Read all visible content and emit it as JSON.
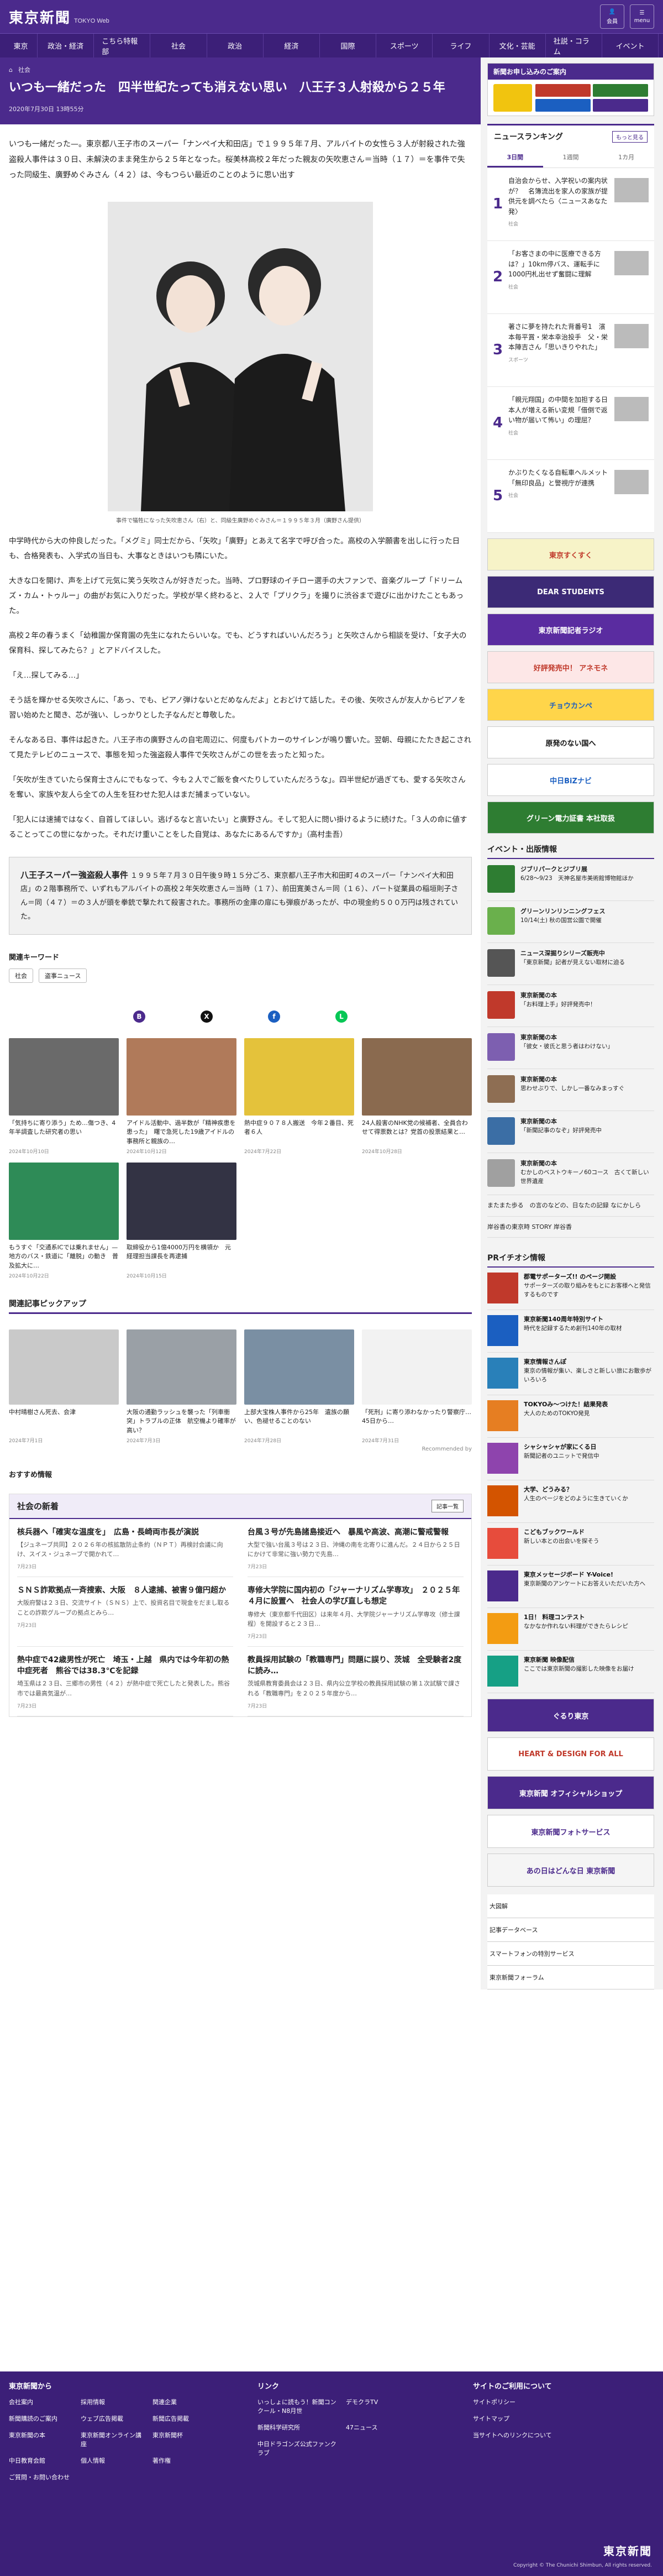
{
  "header": {
    "logo": "東京新聞",
    "logo_sub": "TOKYO Web",
    "btn_member": "会員",
    "btn_menu": "menu"
  },
  "nav": [
    "東京",
    "政治・経済",
    "こちら特報部",
    "社会",
    "政治",
    "経済",
    "国際",
    "スポーツ",
    "ライフ",
    "文化・芸能",
    "社説・コラム",
    "イベント"
  ],
  "article": {
    "breadcrumb_home": "⌂",
    "breadcrumb": "社会",
    "title": "いつも一緒だった　四半世紀たっても消えない思い　八王子３人射殺から２５年",
    "date": "2020年7月30日 13時55分",
    "lead": "いつも一緒だった—。東京都八王子市のスーパー「ナンペイ大和田店」で１９９５年７月、アルバイトの女性ら３人が射殺された強盗殺人事件は３０日、未解決のまま発生から２５年となった。桜美林高校２年だった親友の矢吹恵さん＝当時（１７）＝を事件で失った同級生、廣野めぐみさん（４２）は、今もつらい最近のことのように思い出す",
    "photo_caption": "事件で犠牲になった矢吹恵さん（右）と、同級生廣野めぐみさん＝１９９５年３月（廣野さん提供）",
    "paras": [
      "中学時代から大の仲良しだった。「メグミ」同士だから、「矢吹」「廣野」とあえて名字で呼び合った。高校の入学願書を出しに行った日も、合格発表も、入学式の当日も、大事なときはいつも隣にいた。",
      "大きな口を開け、声を上げて元気に笑う矢吹さんが好きだった。当時、プロ野球のイチロー選手の大ファンで、音楽グループ「ドリームズ・カム・トゥルー」の曲がお気に入りだった。学校が早く終わると、２人で「プリクラ」を撮りに渋谷まで遊びに出かけたこともあった。",
      "高校２年の春うまく「幼稚園か保育園の先生になれたらいいな。でも、どうすればいいんだろう」と矢吹さんから相談を受け、「女子大の保育科、探してみたら？」とアドバイスした。",
      "「え…探してみる…」",
      "そう話を輝かせる矢吹さんに、「あっ、でも、ピアノ弾けないとだめなんだよ」とおどけて話した。その後、矢吹さんが友人からピアノを習い始めたと聞き、芯が強い、しっかりとした子なんだと尊敬した。",
      "そんなある日、事件は起きた。八王子市の廣野さんの自宅周辺に、何度もパトカーのサイレンが鳴り響いた。翌朝、母親にたたき起こされて見たテレビのニュースで、事態を知った強盗殺人事件で矢吹さんがこの世を去ったと知った。",
      "「矢吹が生きていたら保育士さんにでもなって、今も２人でご飯を食べたりしていたんだろうな」。四半世紀が過ぎても、愛する矢吹さんを奪い、家族や友人ら全ての人生を狂わせた犯人はまだ捕まっていない。",
      "「犯人には速捕ではなく、自首してほしい。逃げるなと言いたい」と廣野さん。そして犯人に問い掛けるように続けた。「３人の命に値することってこの世になかった。それだけ重いことをした自覚は、あなたにあるんですか」（高村圭吾）"
    ],
    "box_title": "八王子スーパー強盗殺人事件",
    "box_text": "１９９５年７月３０日午後９時１５分ごろ、東京都八王子市大和田町４のスーパー「ナンペイ大和田店」の２階事務所で、いずれもアルバイトの高校２年矢吹恵さん＝当時（１７）、前田寛美さん＝同（１６）、パート従業員の稲垣則子さん＝同（４７）＝の３人が頭を拳銃で撃たれて殺害された。事務所の金庫の扉にも弾痕があったが、中の現金約５００万円は残されていた。",
    "kw_title": "関連キーワード",
    "keywords": [
      "社会",
      "盗事ニュース"
    ]
  },
  "share": [
    {
      "c": "#4b2a8c",
      "t": "B"
    },
    {
      "c": "#111",
      "t": "X"
    },
    {
      "c": "#1b5fc1",
      "t": "f"
    },
    {
      "c": "#06c755",
      "t": "L"
    }
  ],
  "related": [
    {
      "t": "「気持ちに寄り添う」ため…傷つき、4年半調査した研究者の思い",
      "d": "2024年10月10日"
    },
    {
      "t": "アイドル活動中、過半数が「精神疾患を患った」　曙で急死した19歳アイドルの事務所と親族の…",
      "d": "2024年10月12日"
    },
    {
      "t": "熱中症９０７８人搬送　今年２番目、死者６人",
      "d": "2024年7月22日"
    },
    {
      "t": "24人殺害のNHK党の候補者、全員合わせて得票数とは？党首の投票結果と…",
      "d": "2024年10月28日"
    },
    {
      "t": "もうすぐ「交通系ICでは乗れません」—地方のバス・鉄道に「離脱」の動き　普及拡大に…",
      "d": "2024年10月22日"
    },
    {
      "t": "取締役から1億4000万円を横領か　元経理担当課長を再逮捕",
      "d": "2024年10月15日"
    }
  ],
  "pick_title": "関連記事ピックアップ",
  "picks": [
    {
      "t": "中村晴樹さん死去、会津",
      "d": "2024年7月1日"
    },
    {
      "t": "大阪の通勤ラッシュを襲った「列車衝突」トラブルの正体　航空機より確率が高い？",
      "d": "2024年7月3日"
    },
    {
      "t": "上部大宝株人事件から25年　遺族の願い、色褪せることのない",
      "d": "2024年7月28日"
    },
    {
      "t": "「死刑」に寄り添わなかったり警察庁…　45日から…",
      "d": "2024年7月31日"
    }
  ],
  "rec_label": "Recommended by",
  "osusume": "おすすめ情報",
  "social": {
    "title": "社会の新着",
    "more": "記事一覧",
    "items": [
      {
        "h": "核兵器へ「確実な温度を」　広島・長崎両市長が演説",
        "p": "【ジュネーブ共同】２０２６年の核拡散防止条約（ＮＰＴ）再検討会議に向け、スイス・ジュネーブで開かれて…",
        "d": "7月23日"
      },
      {
        "h": "台風３号が先島諸島接近へ　暴風や高波、高潮に警戒警報",
        "p": "大型で強い台風３号は２３日、沖縄の南を北寄りに進んだ。２４日から２５日にかけて非常に強い勢力で先島…",
        "d": "7月23日"
      },
      {
        "h": "ＳＮＳ詐欺拠点一斉捜索、大阪　８人逮捕、被害９億円超か",
        "p": "大阪府警は２３日、交流サイト（ＳＮＳ）上で、投資名目で現金をだまし取ることの詐欺グループの拠点とみら…",
        "d": "7月23日"
      },
      {
        "h": "専修大学院に国内初の「ジャーナリズム学専攻」　２０２５年４月に設置へ　社会人の学び直しも想定",
        "p": "専修大（東京都千代田区）は来年４月、大学院ジャーナリズム学専攻（修士課程）を開設すると２３日…",
        "d": "7月23日"
      },
      {
        "h": "熱中症で42歳男性が死亡　埼玉・上越　県内では今年初の熱中症死者　熊谷では38.3℃を記録",
        "p": "埼玉県は２３日、三郷市の男性（４２）が熱中症で死亡したと発表した。熊谷市では最高気温が…",
        "d": "7月23日"
      },
      {
        "h": "教員採用試験の「教職専門」問題に誤り、茨城　全受験者2度に読み…",
        "p": "茨城県教育委員会は２３日、県内公立学校の教員採用試験の第１次試験で課される「教職専門」を２０２５年度から…",
        "d": "7月23日"
      }
    ]
  },
  "side": {
    "sub_banner": "新聞お申し込みのご案内",
    "rank_title": "ニュースランキング",
    "rank_more": "もっと見る",
    "rank_tabs": [
      "3日間",
      "1週間",
      "1カ月"
    ],
    "ranking": [
      {
        "n": "1",
        "t": "自治会からせ、入学祝いの案内状が？　名簿流出を家人の家族が提供元を調べたら〈ニュースあなた発〉",
        "c": "社会"
      },
      {
        "n": "2",
        "t": "「お客さまの中に医療できる方は？」10km停バス、運転手に1000円札出せず奮闘に理解",
        "c": "社会"
      },
      {
        "n": "3",
        "t": "著さに夢を持たれた背番号1　濱本毎平賞・栄本幸治投手　父・栄本陣吉さん「思いきりやれた」",
        "c": "スポーツ"
      },
      {
        "n": "4",
        "t": "「親元翔国」の中間を加担する日本人が増える新い変規「借倒で返い物が届いて怖い」の理屈？",
        "c": "社会"
      },
      {
        "n": "5",
        "t": "かぶりたくなる自転車ヘルメット「無印良品」と警視庁が連携",
        "c": "社会"
      }
    ],
    "ads": [
      "東京すくすく",
      "DEAR STUDENTS",
      "東京新聞記者ラジオ",
      "好評発売中！ アネモネ",
      "チョウカンペ",
      "原発のない国へ",
      "中日BiZナビ",
      "グリーン電力証書 本社取扱"
    ],
    "ev_title": "イベント・出版情報",
    "events": [
      {
        "b": "ジブリパークとジブリ展",
        "t": "6/28〜9/23　天神名屋市美術館博物館ほか",
        "c": "#2e7d32"
      },
      {
        "b": "グリーンリンリンニングフェス",
        "t": "10/14(土) 秋の国営公園で開催",
        "c": "#6ab04c"
      },
      {
        "b": "ニュース深掘りシリーズ販売中",
        "t": "「東京新聞」記者が見えない取材に迫る",
        "c": "#555"
      },
      {
        "b": "東京新聞の本",
        "t": "「お料理上手」好評発売中！",
        "c": "#c0392b"
      },
      {
        "b": "東京新聞の本",
        "t": "「彼女・彼氏と思う者はわけない」",
        "c": "#7d5fb0"
      },
      {
        "b": "東京新聞の本",
        "t": "思わせぶりで、しかし一番なみまっすぐ",
        "c": "#8e6e53"
      },
      {
        "b": "東京新聞の本",
        "t": "「新聞記事のなぞ」好評発売中",
        "c": "#3b6ea5"
      },
      {
        "b": "東京新聞の本",
        "t": "むかしのベストウキーノ60コース　古くて新しい世界遺産",
        "c": "#a0a0a0"
      }
    ],
    "more1": "またまた歩る　の言のなどの、日なたの記録 なにかしら",
    "more2": "岸谷香の東京時 STORY 岸谷香",
    "pr_title": "PRイチオシ情報",
    "pr": [
      {
        "b": "郡電サポーターズ!! のページ開設",
        "t": "サポーターズの取り組みをもとにお客様へと発信するものです",
        "c": "#c0392b"
      },
      {
        "b": "東京新聞140周年特別サイト",
        "t": "時代を記録するため創刊140年の取材",
        "c": "#1b5fc1"
      },
      {
        "b": "東京情報さんぽ",
        "t": "東京の情報が集い、楽しさと新しい旅にお散歩がいろいろ",
        "c": "#2980b9"
      },
      {
        "b": "TOKYOみ〜つけた！結果発表",
        "t": "大人のためのTOKYO発見",
        "c": "#e67e22"
      },
      {
        "b": "シャシャシャが家にくる日",
        "t": "新聞記者のユニットで発信中",
        "c": "#8e44ad"
      },
      {
        "b": "大学、どうみる？",
        "t": "人生のページをどのように生きていくか",
        "c": "#d35400"
      },
      {
        "b": "こどもブックワールド",
        "t": "新しい本との出会いを探そう",
        "c": "#e74c3c"
      },
      {
        "b": "東京メッセージボード Y-Voice!",
        "t": "東京新聞のアンケートにお答えいただいた方へ",
        "c": "#4b2a8c"
      },
      {
        "b": "1日！ 料理コンテスト",
        "t": "なかなか作れない料理ができたらレシピ",
        "c": "#f39c12"
      },
      {
        "b": "東京新聞 映像配信",
        "t": "ここでは東京新聞の撮影した映像をお届け",
        "c": "#16a085"
      }
    ],
    "banners2": [
      "ぐるり東京",
      "HEART & DESIGN FOR ALL",
      "東京新聞 オフィシャルショップ",
      "東京新聞フォトサービス",
      "あの日はどんな日 東京新聞"
    ],
    "links": [
      "大図解",
      "記事データベース",
      "スマートフォンの特別サービス",
      "東京新聞フォーラム"
    ]
  },
  "footer": {
    "c1_title": "東京新聞から",
    "c1": [
      "会社案内",
      "採用情報",
      "関連企業",
      "新聞購読のご案内",
      "ウェブ広告掲載",
      "新聞広告掲載",
      "東京新聞の本",
      "東京新聞オンライン講座",
      "東京新聞杯",
      "中日教育会館",
      "個人情報",
      "著作権",
      "ご質問・お問い合わせ"
    ],
    "c2_title": "リンク",
    "c2": [
      "いっしょに読もう！新聞コンクール・N8月世",
      "デモクラTV",
      "新聞科学研究所",
      "47ニュース",
      "中日ドラゴンズ公式ファンクラブ"
    ],
    "c3_title": "サイトのご利用について",
    "c3": [
      "サイトポリシー",
      "サイトマップ",
      "当サイトへのリンクについて"
    ],
    "logo": "東京新聞",
    "copy": "Copyright © The Chunichi Shimbun, All rights reserved."
  }
}
